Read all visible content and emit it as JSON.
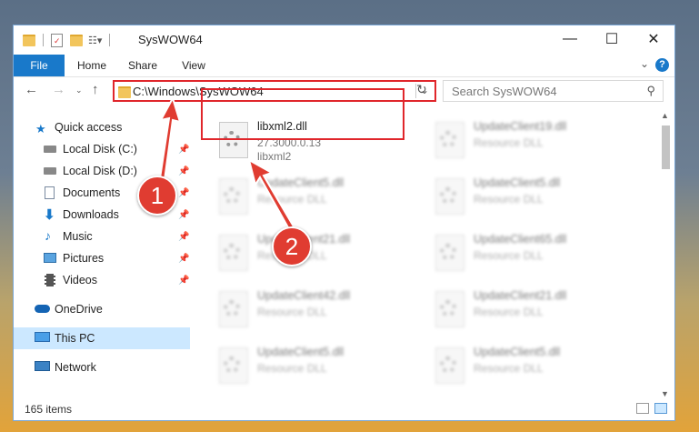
{
  "window": {
    "title": "SysWOW64",
    "controls": {
      "minimize": "—",
      "maximize": "☐",
      "close": "✕"
    }
  },
  "ribbon": {
    "tabs": [
      {
        "label": "File"
      },
      {
        "label": "Home"
      },
      {
        "label": "Share"
      },
      {
        "label": "View"
      }
    ]
  },
  "address": {
    "path": "C:\\Windows\\SysWOW64"
  },
  "search": {
    "placeholder": "Search SysWOW64"
  },
  "nav": {
    "items": [
      {
        "label": "Quick access",
        "icon": "star-icon",
        "pinned": false
      },
      {
        "label": "Local Disk (C:)",
        "icon": "drive-icon",
        "pinned": true
      },
      {
        "label": "Local Disk (D:)",
        "icon": "drive-icon",
        "pinned": true
      },
      {
        "label": "Documents",
        "icon": "documents-icon",
        "pinned": true
      },
      {
        "label": "Downloads",
        "icon": "download-icon",
        "pinned": true
      },
      {
        "label": "Music",
        "icon": "music-icon",
        "pinned": true
      },
      {
        "label": "Pictures",
        "icon": "pictures-icon",
        "pinned": true
      },
      {
        "label": "Videos",
        "icon": "videos-icon",
        "pinned": true
      },
      {
        "label": "OneDrive",
        "icon": "cloud-icon",
        "pinned": false
      },
      {
        "label": "This PC",
        "icon": "computer-icon",
        "pinned": false,
        "selected": true
      },
      {
        "label": "Network",
        "icon": "network-icon",
        "pinned": false
      }
    ]
  },
  "files": {
    "left": [
      {
        "name": "libxml2.dll",
        "line2": "27.3000.0.13",
        "line3": "libxml2"
      },
      {
        "name": "UpdateClient5.dll",
        "line2": "Resource DLL"
      },
      {
        "name": "UpdateClient21.dll",
        "line2": "Resource DLL"
      },
      {
        "name": "UpdateClient42.dll",
        "line2": "Resource DLL"
      },
      {
        "name": "UpdateClient5.dll",
        "line2": "Resource DLL"
      }
    ],
    "right": [
      {
        "name": "UpdateClient19.dll",
        "line2": "Resource DLL"
      },
      {
        "name": "UpdateClient5.dll",
        "line2": "Resource DLL"
      },
      {
        "name": "UpdateClient65.dll",
        "line2": "Resource DLL"
      },
      {
        "name": "UpdateClient21.dll",
        "line2": "Resource DLL"
      },
      {
        "name": "UpdateClient5.dll",
        "line2": "Resource DLL"
      }
    ]
  },
  "status": {
    "count": "165 items"
  },
  "annotations": {
    "badge1": "1",
    "badge2": "2",
    "color": "#e03c31"
  },
  "colors": {
    "accent": "#1979ca",
    "highlight": "#e0262b",
    "selected": "#cce8ff"
  }
}
